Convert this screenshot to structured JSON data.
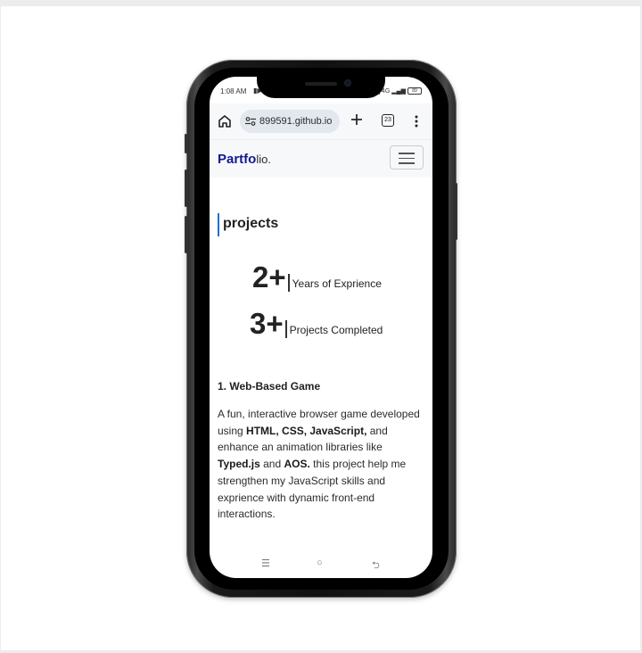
{
  "status_bar": {
    "time": "1:08 AM",
    "media_icon": "play-pause-icon",
    "network": "4G",
    "battery": "89"
  },
  "browser": {
    "url": "899591.github.io",
    "tab_count": "23",
    "icons": [
      "home-icon",
      "tune-icon",
      "plus-icon",
      "tabs-icon",
      "more-vert-icon"
    ]
  },
  "site": {
    "brand_strong": "Partfo",
    "brand_rest": "lio."
  },
  "section": {
    "title": "projects"
  },
  "stats": [
    {
      "number": "2+",
      "label": "Years of Exprience"
    },
    {
      "number": "3+",
      "label": "Projects Completed"
    }
  ],
  "project": {
    "title": "1. Web-Based Game",
    "desc_1": "A fun, interactive browser game developed using ",
    "bold_1": "HTML, CSS, JavaScript,",
    "desc_2": " and enhance an animation libraries like ",
    "bold_2": "Typed.js",
    "desc_3": " and ",
    "bold_3": "AOS.",
    "desc_4": " this project help me strengthen my JavaScript skills and exprience with dynamic front-end interactions."
  },
  "nav_bar": {
    "menu_glyph": "☰",
    "home_glyph": "○",
    "back_glyph": "⮌"
  },
  "colors": {
    "brand_accent": "#131a8f",
    "section_accent": "#1e6fd9"
  }
}
